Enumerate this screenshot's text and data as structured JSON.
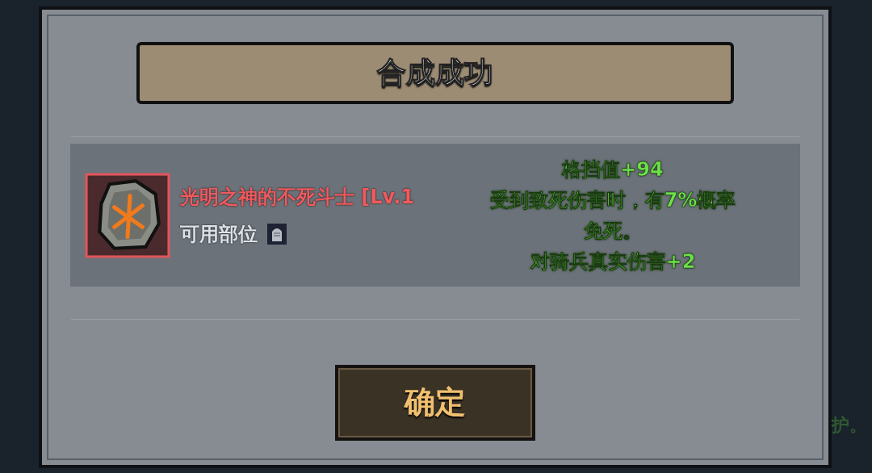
{
  "dialog": {
    "title": "合成成功",
    "item": {
      "name": "光明之神的不死斗士 [Lv.1",
      "slot_label": "可用部位"
    },
    "effects": [
      "格挡值+94",
      "受到致死伤害时，有7%概率",
      "免死。",
      "对骑兵真实伤害+2"
    ],
    "confirm_button": "确定"
  },
  "background_text": "护。"
}
